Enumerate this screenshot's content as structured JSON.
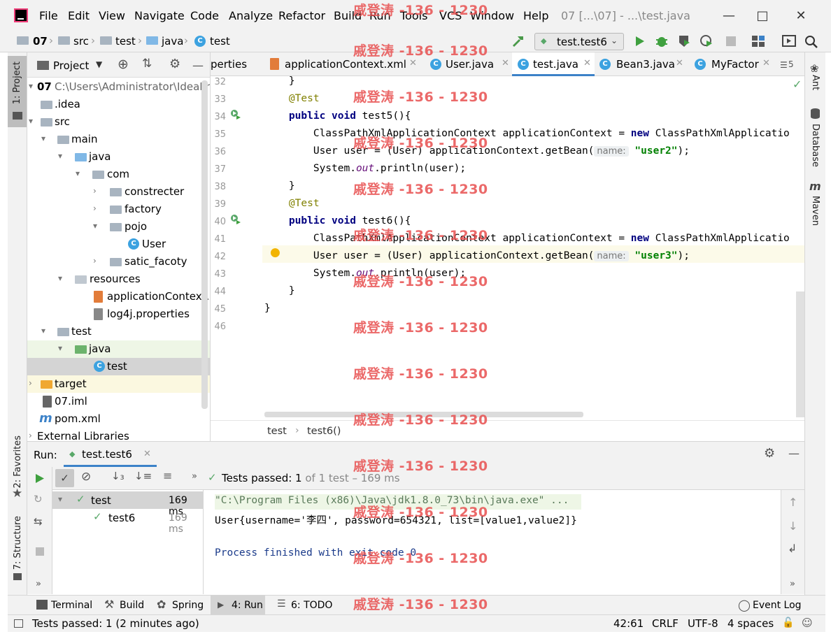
{
  "menu": [
    "File",
    "Edit",
    "View",
    "Navigate",
    "Code",
    "Analyze",
    "Refactor",
    "Build",
    "Run",
    "Tools",
    "VCS",
    "Window",
    "Help"
  ],
  "window_title": "07 [...\\07] - ...\\test.java",
  "nav": {
    "crumbs": [
      "07",
      "src",
      "test",
      "java",
      "test"
    ],
    "run_config": "test.test6"
  },
  "project_panel": {
    "title": "Project",
    "tree": [
      {
        "label": "07",
        "extra": "C:\\Users\\Administrator\\IdeaPr"
      },
      {
        "label": ".idea"
      },
      {
        "label": "src"
      },
      {
        "label": "main"
      },
      {
        "label": "java"
      },
      {
        "label": "com"
      },
      {
        "label": "constrecter"
      },
      {
        "label": "factory"
      },
      {
        "label": "pojo"
      },
      {
        "label": "User"
      },
      {
        "label": "satic_facoty"
      },
      {
        "label": "resources"
      },
      {
        "label": "applicationContext.x"
      },
      {
        "label": "log4j.properties"
      },
      {
        "label": "test"
      },
      {
        "label": "java"
      },
      {
        "label": "test"
      },
      {
        "label": "target"
      },
      {
        "label": "07.iml"
      },
      {
        "label": "pom.xml"
      },
      {
        "label": "External Libraries"
      }
    ]
  },
  "editor_tabs": [
    "perties",
    "applicationContext.xml",
    "User.java",
    "test.java",
    "Bean3.java",
    "MyFactor"
  ],
  "tabs_more": "5",
  "code": {
    "line_numbers": [
      "32",
      "33",
      "34",
      "35",
      "36",
      "37",
      "38",
      "39",
      "40",
      "41",
      "42",
      "43",
      "44",
      "45",
      "46"
    ],
    "lines": [
      {
        "indent": "    ",
        "text": "}"
      },
      {
        "indent": "    ",
        "ann": "@Test"
      },
      {
        "indent": "    ",
        "kw": "public void",
        "rest": " test5(){"
      },
      {
        "indent": "        ",
        "pre": "ClassPathXmlApplicationContext applicationContext = ",
        "kw": "new",
        "rest": " ClassPathXmlApplicatio"
      },
      {
        "indent": "        ",
        "pre": "User user = (User) applicationContext.getBean(",
        "hint": "name:",
        "str": "\"user2\"",
        "rest": ");"
      },
      {
        "indent": "        ",
        "pre": "System.",
        "it": "out",
        "rest": ".println(user);"
      },
      {
        "indent": "    ",
        "text": "}"
      },
      {
        "indent": "    ",
        "ann": "@Test"
      },
      {
        "indent": "    ",
        "kw": "public void",
        "rest": " test6(){"
      },
      {
        "indent": "        ",
        "pre": "ClassPathXmlApplicationContext applicationContext = ",
        "kw": "new",
        "rest": " ClassPathXmlApplicatio"
      },
      {
        "indent": "        ",
        "pre": "User user = (User) applicationContext.getBean(",
        "hint": "name:",
        "str": "\"user3\"",
        "rest": ");"
      },
      {
        "indent": "        ",
        "pre": "System.",
        "it": "out",
        "rest": ".println(user);"
      },
      {
        "indent": "    ",
        "text": "}"
      },
      {
        "indent": "",
        "text": "}"
      },
      {
        "indent": "",
        "text": ""
      }
    ]
  },
  "editor_breadcrumb": [
    "test",
    "test6()"
  ],
  "run": {
    "label": "Run:",
    "tab": "test.test6",
    "status_prefix": "Tests passed: ",
    "status_count": "1",
    "status_rest": " of 1 test – 169 ms",
    "tree": [
      {
        "label": "test",
        "time": "169 ms"
      },
      {
        "label": "test6",
        "time": "169 ms"
      }
    ],
    "console": [
      "\"C:\\Program Files (x86)\\Java\\jdk1.8.0_73\\bin\\java.exe\" ...",
      "User{username='李四', password=654321, list=[value1,value2]}",
      "",
      "Process finished with exit code 0"
    ]
  },
  "left_stripe": [
    "1: Project",
    "2: Favorites",
    "7: Structure"
  ],
  "right_stripe": [
    "Ant",
    "Database",
    "Maven"
  ],
  "bottom_tabs": [
    "Terminal",
    "Build",
    "Spring",
    "4: Run",
    "6: TODO"
  ],
  "event_log": "Event Log",
  "status": {
    "message": "Tests passed: 1 (2 minutes ago)",
    "position": "42:61",
    "line_sep": "CRLF",
    "encoding": "UTF-8",
    "indent": "4 spaces"
  },
  "watermark": "戚登涛 -136 - 1230",
  "colors": {
    "accent": "#3c82c8",
    "pass": "#59a869",
    "watermark": "#e85050",
    "current_line": "#fcfae9"
  }
}
